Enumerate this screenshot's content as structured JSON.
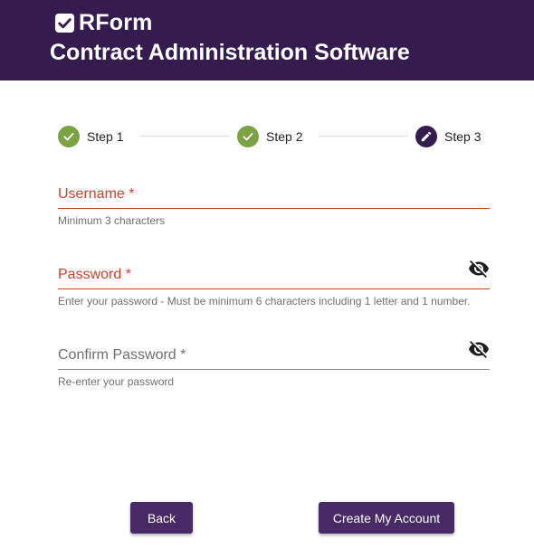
{
  "header": {
    "brand_name": "RForm",
    "app_title": "Contract Administration Software"
  },
  "stepper": {
    "steps": [
      {
        "label": "Step 1",
        "status": "complete",
        "icon": "check-icon"
      },
      {
        "label": "Step 2",
        "status": "complete",
        "icon": "check-icon"
      },
      {
        "label": "Step 3",
        "status": "active",
        "icon": "pencil-icon"
      }
    ]
  },
  "form": {
    "username": {
      "label": "Username *",
      "helper": "Minimum 3 characters",
      "value": ""
    },
    "password": {
      "label": "Password *",
      "helper": "Enter your password - Must be minimum 6 characters including 1 letter and 1 number.",
      "value": "",
      "toggle_icon": "eye-off-icon"
    },
    "confirm_password": {
      "label": "Confirm Password *",
      "helper": "Re-enter your password",
      "value": "",
      "toggle_icon": "eye-off-icon"
    }
  },
  "actions": {
    "back_label": "Back",
    "create_label": "Create My Account"
  },
  "colors": {
    "header_bg": "#341c4f",
    "button_bg": "#472a66",
    "step_complete": "#7ca343",
    "step_active": "#341c4f",
    "error": "#c9402d"
  }
}
